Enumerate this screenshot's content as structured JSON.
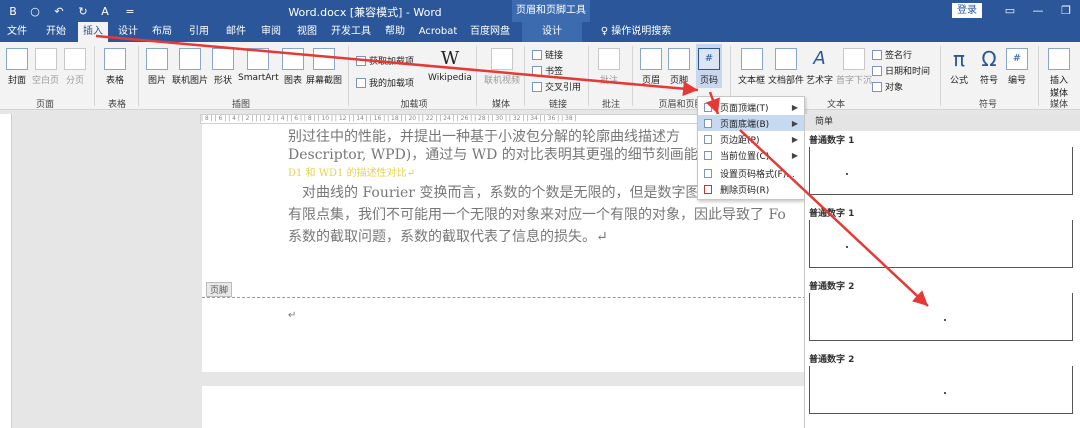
{
  "titlebar": {
    "doc_title": "Word.docx [兼容模式]  -  Word",
    "context_group": "页眉和页脚工具",
    "login": "登录",
    "quick_access": [
      "B",
      "○",
      "↶",
      "↻",
      "A",
      "="
    ],
    "window_controls": [
      "▭",
      "—",
      "❐"
    ]
  },
  "tabs": [
    "文件",
    "开始",
    "插入",
    "设计",
    "布局",
    "引用",
    "邮件",
    "审阅",
    "视图",
    "开发工具",
    "帮助",
    "Acrobat",
    "百度网盘",
    "设计"
  ],
  "tell_me": "操作说明搜索",
  "ribbon": {
    "groups": [
      "页面",
      "表格",
      "插图",
      "加载项",
      "媒体",
      "链接",
      "批注",
      "页眉和页脚",
      "文本",
      "符号",
      "媒体"
    ],
    "pages": {
      "cover": "封面",
      "blank": "空白页",
      "break": "分页"
    },
    "table": "表格",
    "illustrations": [
      "图片",
      "联机图片",
      "形状",
      "SmartArt",
      "图表",
      "屏幕截图"
    ],
    "addins": {
      "get": "获取加载项",
      "mine": "我的加载项",
      "wikipedia": "Wikipedia"
    },
    "media": "联机视频",
    "links": [
      "链接",
      "书签",
      "交叉引用"
    ],
    "comment": "批注",
    "header_footer": [
      "页眉",
      "页脚",
      "页码"
    ],
    "text": [
      "文本框",
      "文档部件",
      "艺术字",
      "首字下沉",
      "签名行",
      "日期和时间",
      "对象"
    ],
    "symbols": [
      "公式",
      "符号",
      "编号"
    ],
    "insert_media": "插入媒体"
  },
  "ruler_text": "| 8 | | 6 | | 4 | | 2 | | | | 2 | | 4 | | 6 | | 8 | | 10 | | 12 | | 14 | | 16 | | 18 | | 20 | | 22 | | 24 | | 26 | | 28 | | 30 | | 32 | | 34 | | 36 | | 38 |",
  "doc": {
    "line1": "别过往中的性能，并提出一种基于小波包分解的轮廓曲线描述方",
    "line2": "Descriptor, WPD)，通过与 WD 的对比表明其更强的细节刻画能",
    "line3": "D1 和 WD1 的描述性对比↵",
    "line4": "　对曲线的 Fourier 变换而言，系数的个数是无限的，但是数字图",
    "line5": "有限点集，我们不可能用一个无限的对象来对应一个有限的对象，因此导致了 Fo",
    "line6": "系数的截取问题，系数的截取代表了信息的损失。↵",
    "footer_label": "页脚",
    "return_mark": "↵"
  },
  "menu": [
    {
      "label": "页面顶端(T)",
      "submenu": true
    },
    {
      "label": "页面底端(B)",
      "submenu": true
    },
    {
      "label": "页边距(P)",
      "submenu": true
    },
    {
      "label": "当前位置(C)",
      "submenu": true
    },
    {
      "label": "设置页码格式(F)...",
      "submenu": false
    },
    {
      "label": "删除页码(R)",
      "submenu": false
    }
  ],
  "gallery": {
    "header": "简单",
    "items": [
      "普通数字 1",
      "普通数字 1",
      "普通数字 2",
      "普通数字 2"
    ]
  },
  "colors": {
    "accent": "#2b579a",
    "annotation": "#e53935",
    "highlight": "#c5d9f1"
  }
}
